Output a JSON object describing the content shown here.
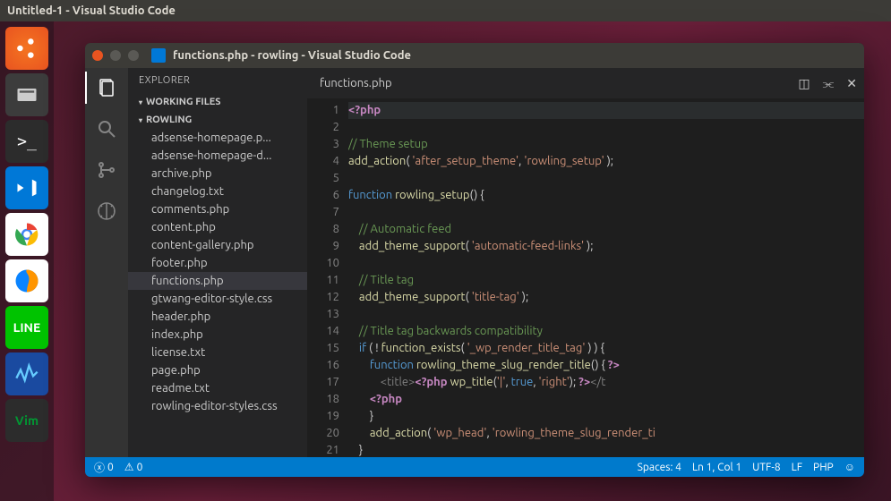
{
  "desktop": {
    "menubar_title": "Untitled-1 - Visual Studio Code"
  },
  "window": {
    "title": "functions.php - rowling - Visual Studio Code"
  },
  "sidebar": {
    "title": "EXPLORER",
    "sections": {
      "working": "WORKING FILES",
      "project": "ROWLING"
    },
    "files": [
      "adsense-homepage.p...",
      "adsense-homepage-d...",
      "archive.php",
      "changelog.txt",
      "comments.php",
      "content.php",
      "content-gallery.php",
      "footer.php",
      "functions.php",
      "gtwang-editor-style.css",
      "header.php",
      "index.php",
      "license.txt",
      "page.php",
      "readme.txt",
      "rowling-editor-styles.css"
    ],
    "active_file_index": 8
  },
  "tab": {
    "name": "functions.php"
  },
  "code_lines": [
    {
      "n": 1,
      "html": "<span class='php'>&lt;?php</span>"
    },
    {
      "n": 2,
      "html": ""
    },
    {
      "n": 3,
      "html": "<span class='cmt'>// Theme setup</span>"
    },
    {
      "n": 4,
      "html": "<span class='fn'>add_action</span>( <span class='str'>'after_setup_theme'</span>, <span class='str'>'rowling_setup'</span> );"
    },
    {
      "n": 5,
      "html": ""
    },
    {
      "n": 6,
      "html": "<span class='kw'>function</span> <span class='fn'>rowling_setup</span>() {"
    },
    {
      "n": 7,
      "html": ""
    },
    {
      "n": 8,
      "html": "    <span class='cmt'>// Automatic feed</span>"
    },
    {
      "n": 9,
      "html": "    <span class='fn'>add_theme_support</span>( <span class='str'>'automatic-feed-links'</span> );"
    },
    {
      "n": 10,
      "html": ""
    },
    {
      "n": 11,
      "html": "    <span class='cmt'>// Title tag</span>"
    },
    {
      "n": 12,
      "html": "    <span class='fn'>add_theme_support</span>( <span class='str'>'title-tag'</span> );"
    },
    {
      "n": 13,
      "html": ""
    },
    {
      "n": 14,
      "html": "    <span class='cmt'>// Title tag backwards compatibility</span>"
    },
    {
      "n": 15,
      "html": "    <span class='kw'>if</span> ( ! <span class='fn'>function_exists</span>( <span class='str'>'_wp_render_title_tag'</span> ) ) {"
    },
    {
      "n": 16,
      "html": "        <span class='kw'>function</span> <span class='fn'>rowling_theme_slug_render_title</span>() { <span class='php'>?&gt;</span>"
    },
    {
      "n": 17,
      "html": "            <span class='tag'>&lt;title&gt;</span><span class='php'>&lt;?php</span> <span class='fn'>wp_title</span>(<span class='str'>'|'</span>, <span class='kw'>true</span>, <span class='str'>'right'</span>); <span class='php'>?&gt;</span><span class='tag'>&lt;/t</span>"
    },
    {
      "n": 18,
      "html": "        <span class='php'>&lt;?php</span>"
    },
    {
      "n": 19,
      "html": "        }"
    },
    {
      "n": 20,
      "html": "        <span class='fn'>add_action</span>( <span class='str'>'wp_head'</span>, <span class='str'>'rowling_theme_slug_render_ti</span>"
    },
    {
      "n": 21,
      "html": "    }"
    }
  ],
  "status": {
    "errors": "0",
    "warnings": "0",
    "spaces": "Spaces: 4",
    "cursor": "Ln 1, Col 1",
    "encoding": "UTF-8",
    "eol": "LF",
    "lang": "PHP"
  }
}
